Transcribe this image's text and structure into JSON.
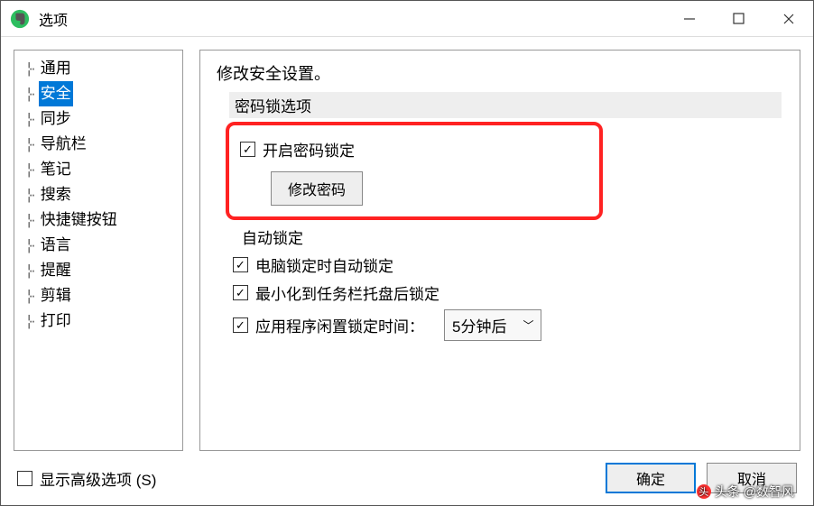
{
  "window": {
    "title": "选项"
  },
  "sidebar": {
    "items": [
      {
        "label": "通用",
        "selected": false
      },
      {
        "label": "安全",
        "selected": true
      },
      {
        "label": "同步",
        "selected": false
      },
      {
        "label": "导航栏",
        "selected": false
      },
      {
        "label": "笔记",
        "selected": false
      },
      {
        "label": "搜索",
        "selected": false
      },
      {
        "label": "快捷键按钮",
        "selected": false
      },
      {
        "label": "语言",
        "selected": false
      },
      {
        "label": "提醒",
        "selected": false
      },
      {
        "label": "剪辑",
        "selected": false
      },
      {
        "label": "打印",
        "selected": false
      }
    ]
  },
  "main": {
    "heading": "修改安全设置。",
    "group_password": "密码锁选项",
    "enable_password_lock": {
      "label": "开启密码锁定",
      "checked": true
    },
    "change_password_btn": "修改密码",
    "auto_lock_heading": "自动锁定",
    "lock_on_pc_lock": {
      "label": "电脑锁定时自动锁定",
      "checked": true
    },
    "lock_on_minimize": {
      "label": "最小化到任务栏托盘后锁定",
      "checked": true
    },
    "idle_lock": {
      "label": "应用程序闲置锁定时间：",
      "checked": true
    },
    "idle_time_selected": "5分钟后"
  },
  "footer": {
    "show_advanced": {
      "label": "显示高级选项 (S)",
      "checked": false
    },
    "ok": "确定",
    "cancel": "取消"
  },
  "watermark": "头条 @数智风"
}
